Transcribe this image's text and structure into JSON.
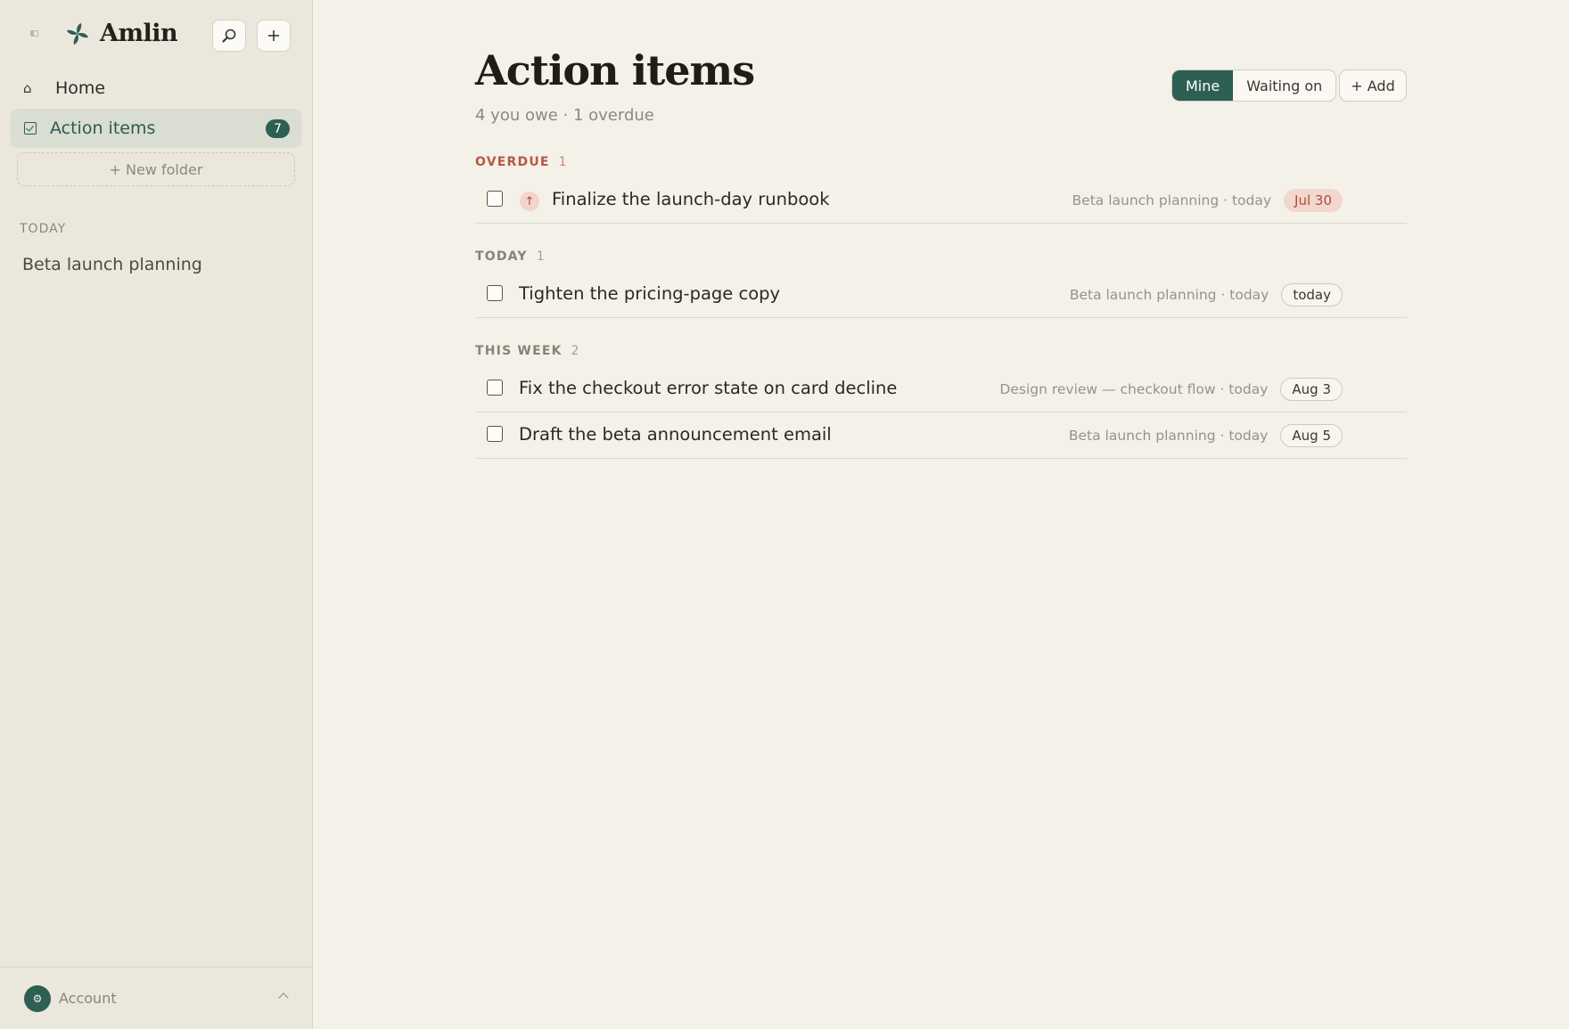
{
  "sidebar": {
    "brand": "Amlin",
    "nav": [
      {
        "label": "Home",
        "icon": "home-icon"
      },
      {
        "label": "Action items",
        "icon": "checkbox-icon",
        "badge": "7"
      }
    ],
    "new_folder": "+ New folder",
    "section_label": "TODAY",
    "recent_items": [
      "Beta launch planning"
    ],
    "account": {
      "label": "Account"
    }
  },
  "main": {
    "title": "Action items",
    "subtitle": "4 you owe · 1 overdue",
    "toggle": {
      "mine": "Mine",
      "waiting_on": "Waiting on",
      "selected": "Mine"
    },
    "add_label": "+ Add",
    "groups": [
      {
        "label": "OVERDUE",
        "count": "1",
        "items": [
          {
            "title": "Finalize the launch-day runbook",
            "meta": "Beta launch planning · today",
            "due": "Jul 30",
            "high_priority": true
          }
        ]
      },
      {
        "label": "TODAY",
        "count": "1",
        "items": [
          {
            "title": "Tighten the pricing-page copy",
            "meta": "Beta launch planning · today",
            "due": "today"
          }
        ]
      },
      {
        "label": "THIS WEEK",
        "count": "2",
        "items": [
          {
            "title": "Fix the checkout error state on card decline",
            "meta": "Design review — checkout flow · today",
            "due": "Aug 3"
          },
          {
            "title": "Draft the beta announcement email",
            "meta": "Beta launch planning · today",
            "due": "Aug 5"
          }
        ]
      }
    ]
  },
  "colors": {
    "accent": "#2e5f53",
    "overdue": "#b65845",
    "background": "#f4f1e9",
    "sidebar_bg": "#ebe7dd"
  }
}
